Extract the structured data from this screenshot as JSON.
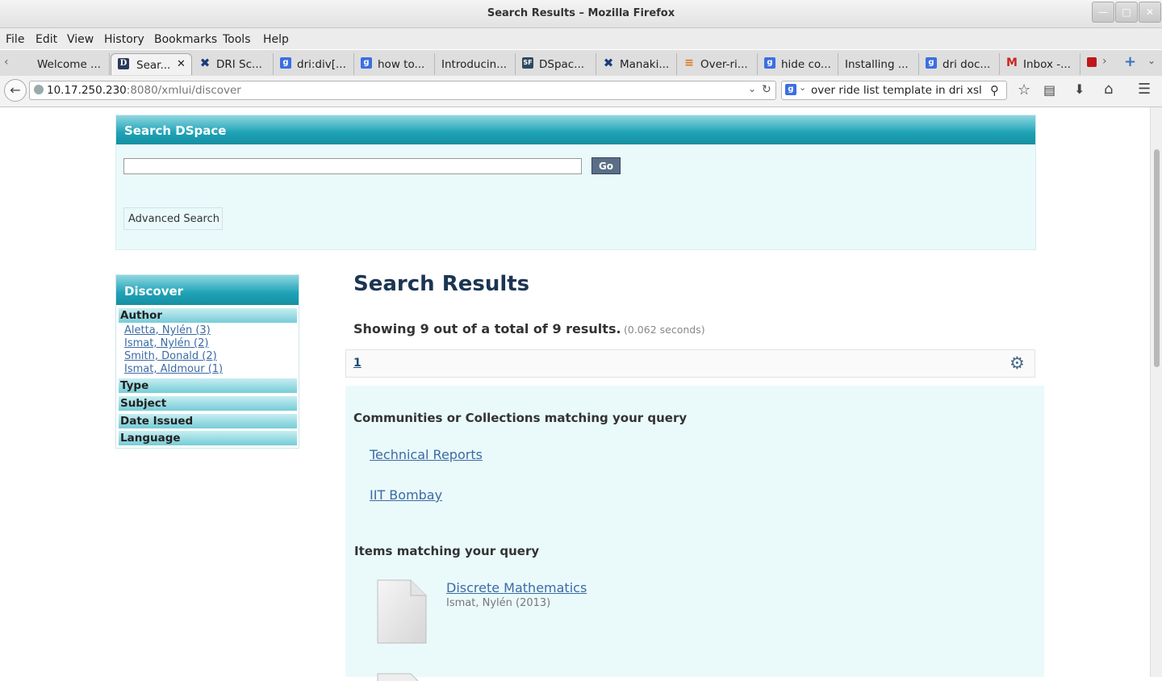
{
  "window": {
    "title": "Search Results – Mozilla Firefox"
  },
  "menu": [
    "File",
    "Edit",
    "View",
    "History",
    "Bookmarks",
    "Tools",
    "Help"
  ],
  "tabs": [
    {
      "label": "Welcome ...",
      "icon": "none"
    },
    {
      "label": "Sear...",
      "icon": "dspace-d-icon",
      "active": true
    },
    {
      "label": "DRI Sc...",
      "icon": "tools-icon"
    },
    {
      "label": "dri:div[...",
      "icon": "google-icon"
    },
    {
      "label": "how to...",
      "icon": "google-icon"
    },
    {
      "label": "Introducin...",
      "icon": "none"
    },
    {
      "label": "DSpac...",
      "icon": "sourceforge-icon"
    },
    {
      "label": "Manaki...",
      "icon": "tools-icon"
    },
    {
      "label": "Over-ri...",
      "icon": "stackoverflow-icon"
    },
    {
      "label": "hide co...",
      "icon": "google-icon"
    },
    {
      "label": "Installing ...",
      "icon": "none"
    },
    {
      "label": "dri doc...",
      "icon": "google-icon"
    },
    {
      "label": "Inbox -...",
      "icon": "gmail-icon"
    }
  ],
  "nav": {
    "url_host": "10.17.250.230",
    "url_path": ":8080/xmlui/discover",
    "search_value": "over ride list template in dri xsl"
  },
  "search": {
    "title": "Search DSpace",
    "query": "",
    "go_label": "Go",
    "advanced_label": "Advanced Search"
  },
  "discover": {
    "title": "Discover",
    "facets": [
      {
        "label": "Author",
        "items": [
          "Aletta, Nylén (3)",
          "Ismat, Nylén (2)",
          "Smith, Donald (2)",
          "Ismat, Aldmour (1)"
        ]
      },
      {
        "label": "Type",
        "items": []
      },
      {
        "label": "Subject",
        "items": []
      },
      {
        "label": "Date Issued",
        "items": []
      },
      {
        "label": "Language",
        "items": []
      }
    ]
  },
  "results": {
    "title": "Search Results",
    "summary": "Showing 9 out of a total of 9 results.",
    "time": "(0.062 seconds)",
    "page": "1",
    "communities_heading": "Communities or Collections matching your query",
    "communities": [
      "Technical Reports",
      "IIT Bombay"
    ],
    "items_heading": "Items matching your query",
    "items": [
      {
        "title": "Discrete Mathematics",
        "meta": "Ismat, Nylén (2013)"
      }
    ]
  },
  "colors": {
    "teal": "#1ea2b6",
    "panel": "#eafafb",
    "link": "#3b6ba4",
    "title": "#1b3553"
  }
}
